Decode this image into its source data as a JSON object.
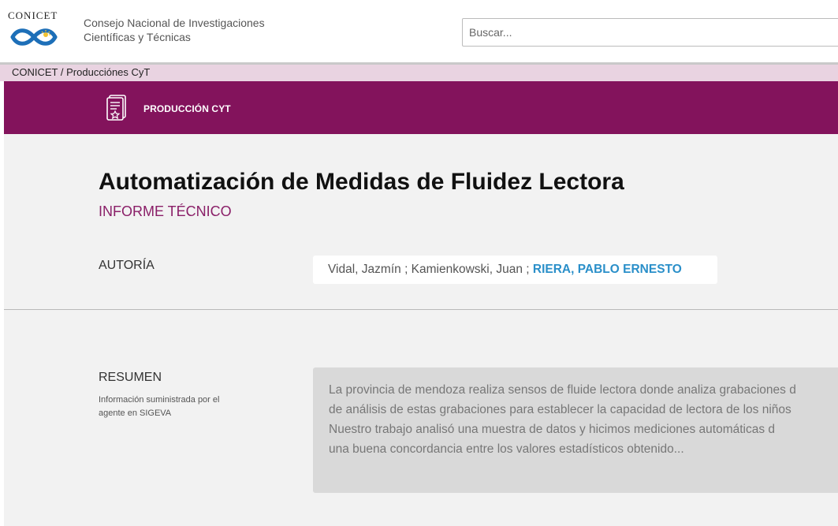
{
  "header": {
    "logo_text": "CONICET",
    "org_name_line1": "Consejo Nacional de Investigaciones",
    "org_name_line2": "Científicas y Técnicas",
    "search_placeholder": "Buscar..."
  },
  "breadcrumb": {
    "home": "CONICET",
    "separator": "/",
    "current": "Producciónes CyT"
  },
  "section_band": {
    "label": "PRODUCCIÓN CYT",
    "icon": "document-certificate-icon",
    "color": "#83135c"
  },
  "record": {
    "title": "Automatización de Medidas de Fluidez Lectora",
    "type": "INFORME TÉCNICO",
    "authorship_label": "AUTORÍA",
    "authors_plain": "Vidal, Jazmín ; Kamienkowski, Juan ; ",
    "author_highlight": "RIERA, PABLO ERNESTO",
    "abstract_label": "RESUMEN",
    "abstract_note": "Información suministrada por el agente en SIGEVA",
    "abstract_lines": [
      "La provincia de mendoza realiza sensos de fluide lectora donde analiza grabaciones d",
      "de análisis de estas grabaciones para establecer la capacidad de lectora de los niños",
      "Nuestro trabajo analisó una muestra de datos y hicimos mediciones automáticas d",
      "una buena concordancia entre los valores estadísticos obtenido..."
    ]
  },
  "colors": {
    "accent_purple": "#83135c",
    "breadcrumb_bg": "#e9d3e1",
    "author_link": "#2a8fc9"
  }
}
